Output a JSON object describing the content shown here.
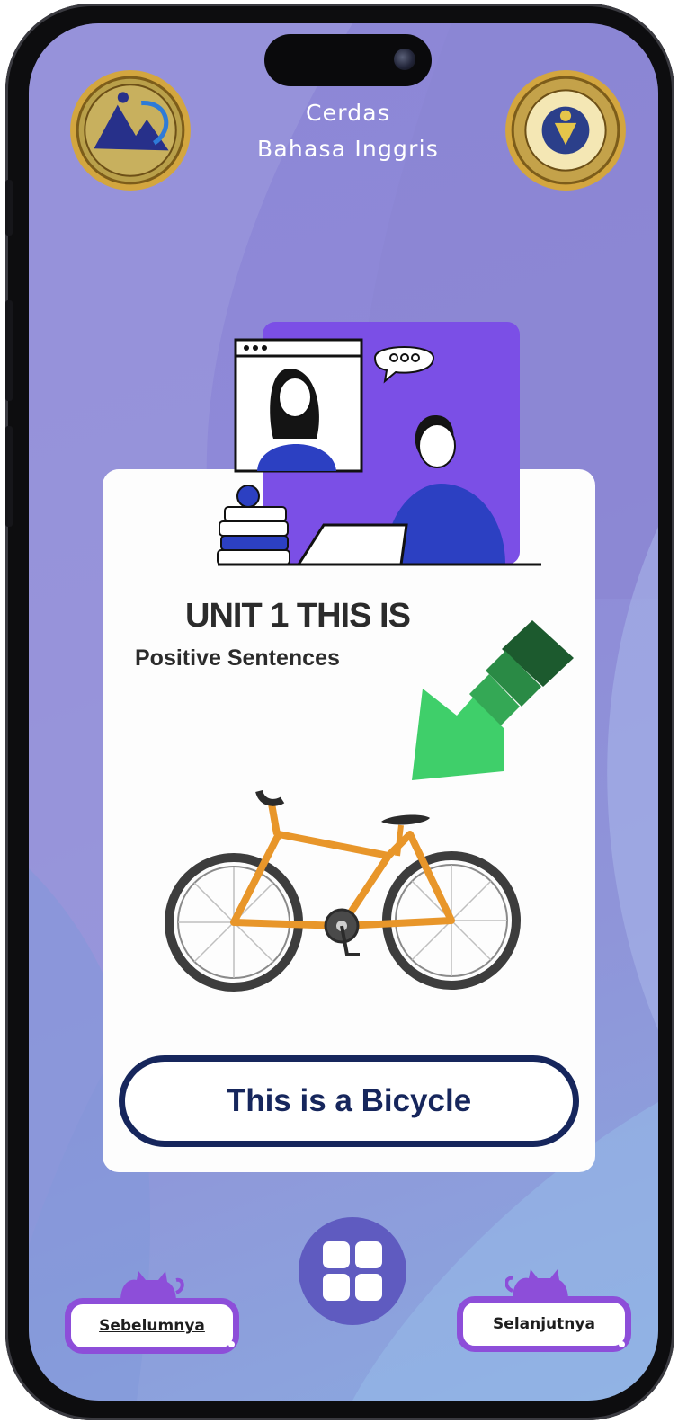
{
  "app": {
    "title_line1": "Cerdas",
    "title_line2": "Bahasa Inggris"
  },
  "lesson": {
    "unit_title": "UNIT 1 THIS IS",
    "subtitle": "Positive Sentences",
    "sentence": "This is a Bicycle"
  },
  "navigation": {
    "previous_label": "Sebelumnya",
    "next_label": "Selanjutnya",
    "menu_icon": "grid-menu-icon"
  },
  "colors": {
    "background": "#8f8ad8",
    "card": "#fdfdfd",
    "sentence_border": "#16265c",
    "menu_button": "#5f5bc0",
    "nav_border": "#8d4ed9",
    "arrow": "#3fcf6a",
    "bicycle_frame": "#e8962a"
  },
  "images": {
    "illustration": "online-tutoring-illustration",
    "arrow": "green-arrow-down-left",
    "subject": "bicycle"
  }
}
